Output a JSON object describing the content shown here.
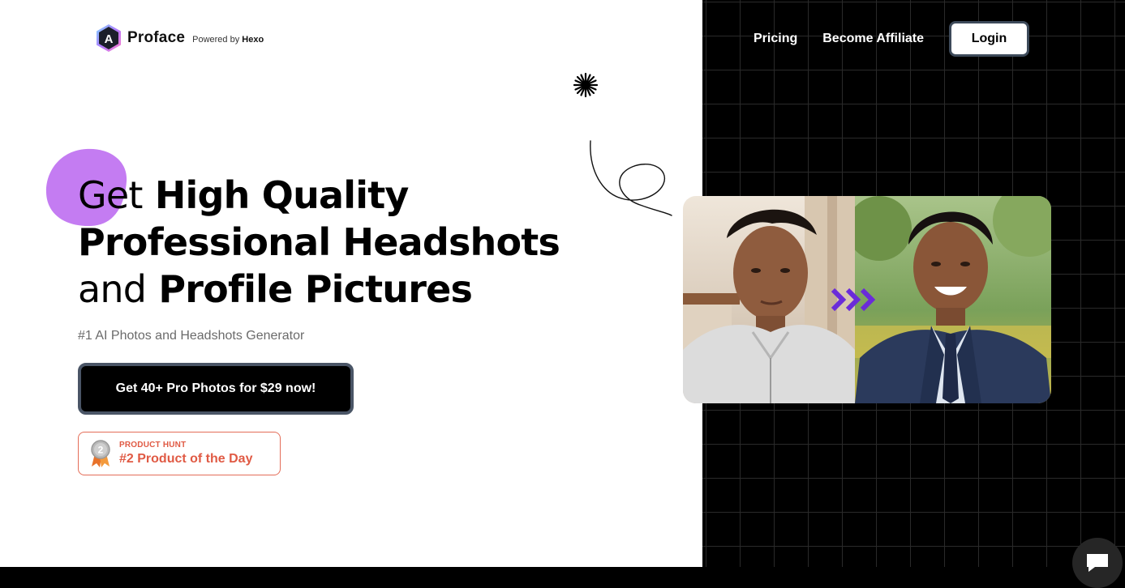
{
  "brand": {
    "logo_letter": "A",
    "name": "Proface",
    "powered_prefix": "Powered by",
    "powered_name": "Hexo"
  },
  "nav": {
    "pricing": "Pricing",
    "affiliate": "Become Affiliate",
    "login": "Login"
  },
  "hero": {
    "line1_light": "Get",
    "line1_bold": "High Quality",
    "line2_bold": "Professional Headshots",
    "line3_light": "and",
    "line3_bold": "Profile Pictures",
    "subline": "#1 AI Photos and Headshots Generator",
    "cta": "Get 40+ Pro Photos for $29 now!"
  },
  "product_hunt": {
    "medal_number": "2",
    "label": "PRODUCT HUNT",
    "award": "#2 Product of the Day"
  },
  "icons": {
    "logo": "hexagon-logo-icon",
    "spark": "sparkle-icon",
    "squiggle": "squiggle-decoration",
    "medal": "medal-icon",
    "arrows": "triple-chevron-right-icon",
    "chat": "chat-bubble-icon"
  },
  "colors": {
    "accent_purple": "#c47cf2",
    "arrow_purple": "#6a2bd9",
    "badge_coral": "#e05a44",
    "button_border": "#4a5566",
    "right_bg": "#000000"
  }
}
